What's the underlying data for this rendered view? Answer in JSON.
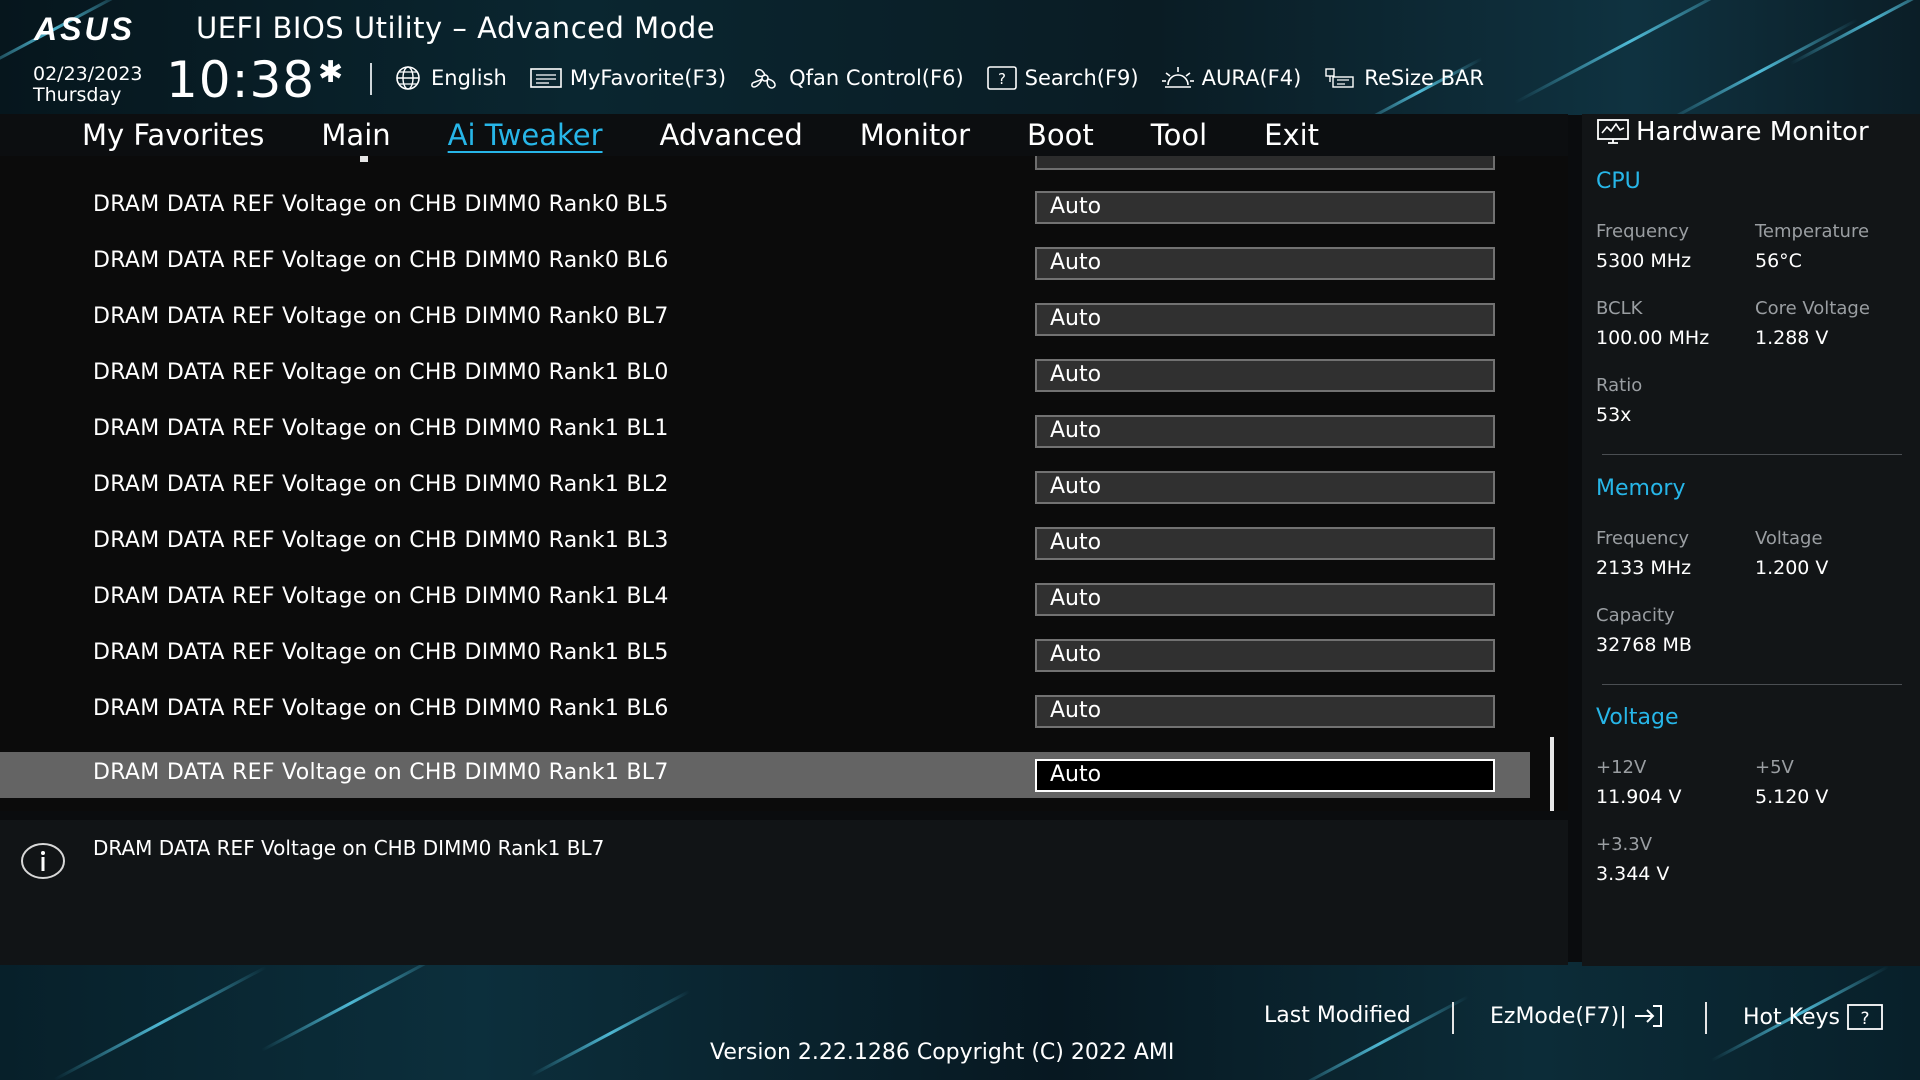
{
  "header": {
    "logo_text": "ASUS",
    "title": "UEFI BIOS Utility – Advanced Mode",
    "date": "02/23/2023",
    "day": "Thursday",
    "time": "10:38"
  },
  "toolbar": [
    {
      "label": "English",
      "icon": "globe-icon"
    },
    {
      "label": "MyFavorite(F3)",
      "icon": "favorite-icon"
    },
    {
      "label": "Qfan Control(F6)",
      "icon": "fan-icon"
    },
    {
      "label": "Search(F9)",
      "icon": "search-icon"
    },
    {
      "label": "AURA(F4)",
      "icon": "aura-icon"
    },
    {
      "label": "ReSize BAR",
      "icon": "resize-bar-icon"
    }
  ],
  "menu": [
    {
      "label": "My Favorites",
      "active": false
    },
    {
      "label": "Main",
      "active": false
    },
    {
      "label": "Ai Tweaker",
      "active": true
    },
    {
      "label": "Advanced",
      "active": false
    },
    {
      "label": "Monitor",
      "active": false
    },
    {
      "label": "Boot",
      "active": false
    },
    {
      "label": "Tool",
      "active": false
    },
    {
      "label": "Exit",
      "active": false
    }
  ],
  "settings": [
    {
      "label": "DRAM DATA REF Voltage on CHB DIMM0 Rank0 BL5",
      "value": "Auto"
    },
    {
      "label": "DRAM DATA REF Voltage on CHB DIMM0 Rank0 BL6",
      "value": "Auto"
    },
    {
      "label": "DRAM DATA REF Voltage on CHB DIMM0 Rank0 BL7",
      "value": "Auto"
    },
    {
      "label": "DRAM DATA REF Voltage on CHB DIMM0 Rank1 BL0",
      "value": "Auto"
    },
    {
      "label": "DRAM DATA REF Voltage on CHB DIMM0 Rank1 BL1",
      "value": "Auto"
    },
    {
      "label": "DRAM DATA REF Voltage on CHB DIMM0 Rank1 BL2",
      "value": "Auto"
    },
    {
      "label": "DRAM DATA REF Voltage on CHB DIMM0 Rank1 BL3",
      "value": "Auto"
    },
    {
      "label": "DRAM DATA REF Voltage on CHB DIMM0 Rank1 BL4",
      "value": "Auto"
    },
    {
      "label": "DRAM DATA REF Voltage on CHB DIMM0 Rank1 BL5",
      "value": "Auto"
    },
    {
      "label": "DRAM DATA REF Voltage on CHB DIMM0 Rank1 BL6",
      "value": "Auto"
    },
    {
      "label": "DRAM DATA REF Voltage on CHB DIMM0 Rank1 BL7",
      "value": "Auto",
      "selected": true
    }
  ],
  "help": {
    "text": "DRAM DATA REF Voltage on CHB DIMM0 Rank1 BL7"
  },
  "hardware_monitor": {
    "title": "Hardware Monitor",
    "cpu": {
      "heading": "CPU",
      "frequency_label": "Frequency",
      "frequency": "5300 MHz",
      "temperature_label": "Temperature",
      "temperature": "56°C",
      "bclk_label": "BCLK",
      "bclk": "100.00 MHz",
      "core_voltage_label": "Core Voltage",
      "core_voltage": "1.288 V",
      "ratio_label": "Ratio",
      "ratio": "53x"
    },
    "memory": {
      "heading": "Memory",
      "frequency_label": "Frequency",
      "frequency": "2133 MHz",
      "voltage_label": "Voltage",
      "voltage": "1.200 V",
      "capacity_label": "Capacity",
      "capacity": "32768 MB"
    },
    "voltage": {
      "heading": "Voltage",
      "v12_label": "+12V",
      "v12": "11.904 V",
      "v5_label": "+5V",
      "v5": "5.120 V",
      "v33_label": "+3.3V",
      "v33": "3.344 V"
    }
  },
  "footer": {
    "last_modified": "Last Modified",
    "ezmode": "EzMode(F7)|",
    "hot_keys": "Hot Keys",
    "version": "Version 2.22.1286 Copyright (C) 2022 AMI"
  },
  "colors": {
    "accent": "#27b6e8",
    "selected_row": "#646464",
    "value_box": "#303030"
  }
}
